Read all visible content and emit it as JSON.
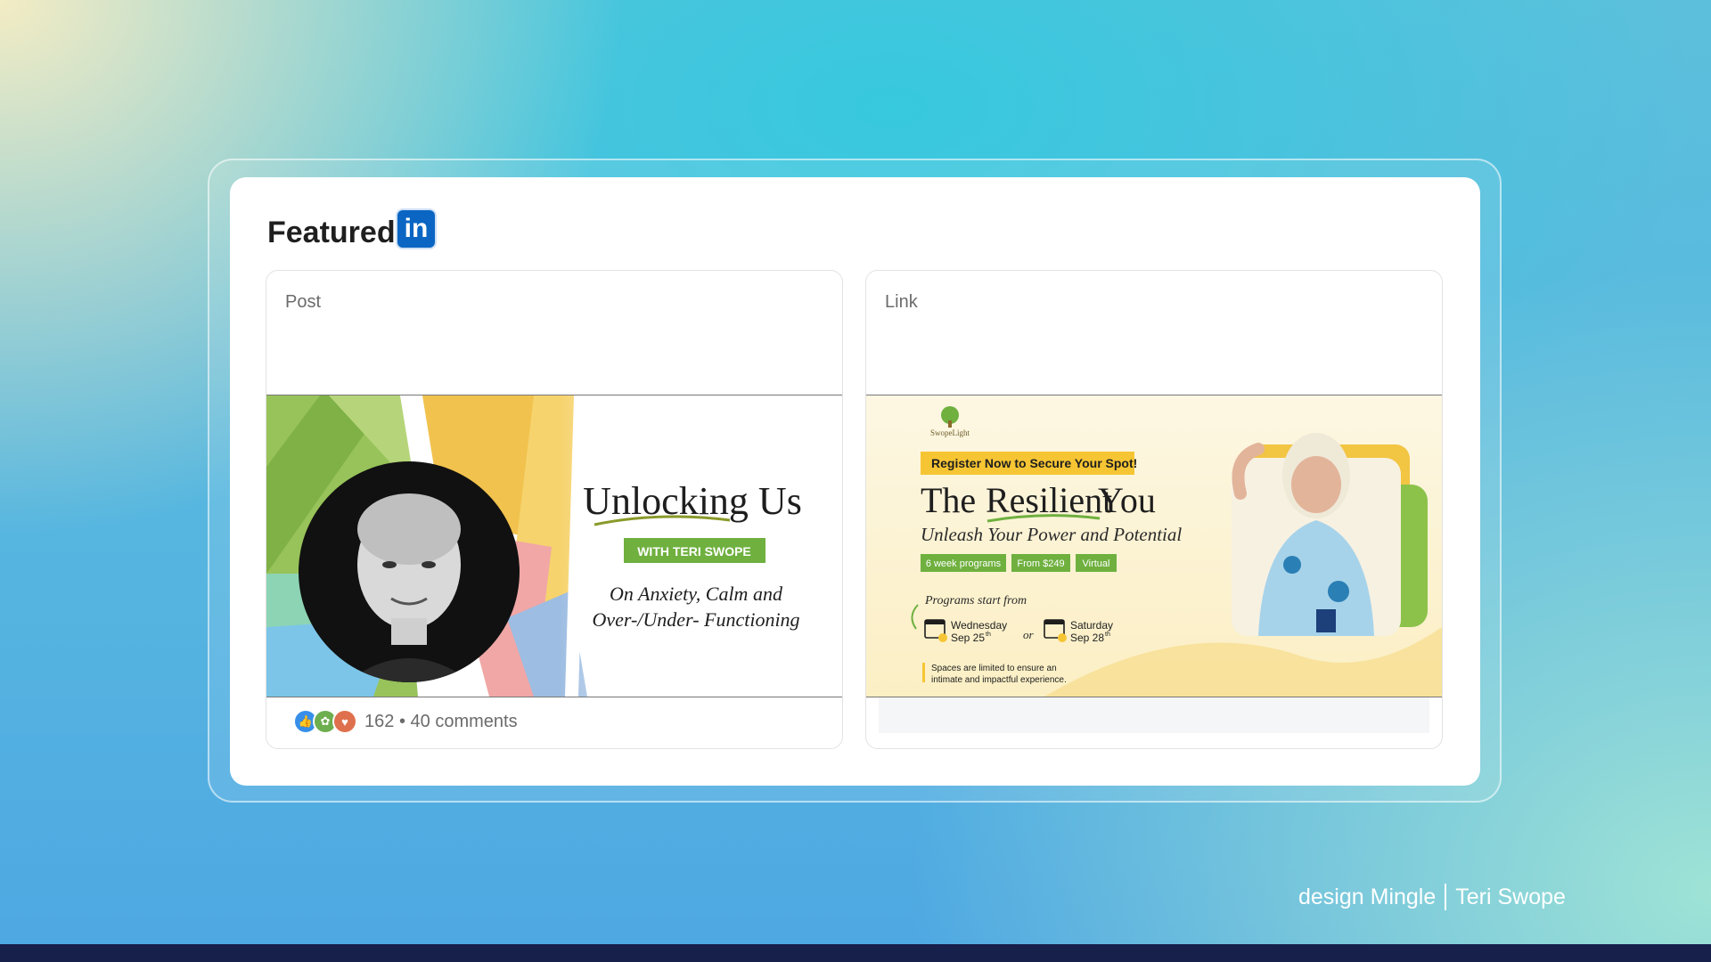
{
  "featured": {
    "title": "Featured",
    "logo_text": "in"
  },
  "post_card": {
    "label": "Post",
    "image": {
      "title": "Unlocking Us",
      "badge": "WITH   TERI SWOPE",
      "subtitle_line1": "On Anxiety, Calm and",
      "subtitle_line2": "Over-/Under- Functioning"
    },
    "reactions": {
      "icons": [
        "like-icon",
        "support-icon",
        "love-icon"
      ],
      "count": "162",
      "separator": "•",
      "comments": "40 comments"
    }
  },
  "link_card": {
    "label": "Link",
    "image": {
      "brand": "SwopeLight",
      "register_banner": "Register Now to Secure Your Spot!",
      "title_the": "The",
      "title_resilient": "Resilient",
      "title_you": "You",
      "tagline": "Unleash Your Power and Potential",
      "tags": [
        "6 week programs",
        "From $249",
        "Virtual"
      ],
      "programs_start": "Programs start from",
      "date1_day": "Wednesday",
      "date1_date": "Sep 25",
      "date1_sup": "th",
      "or": "or",
      "date2_day": "Saturday",
      "date2_date": "Sep 28",
      "date2_sup": "th",
      "note_line1": "Spaces are limited to ensure an",
      "note_line2": "intimate and impactful experience."
    }
  },
  "credit": {
    "left": "design Mingle",
    "right": "Teri Swope"
  },
  "colors": {
    "linkedin": "#0a66c2",
    "accent_green": "#6fb03f",
    "banner_yellow": "#f6c533"
  }
}
